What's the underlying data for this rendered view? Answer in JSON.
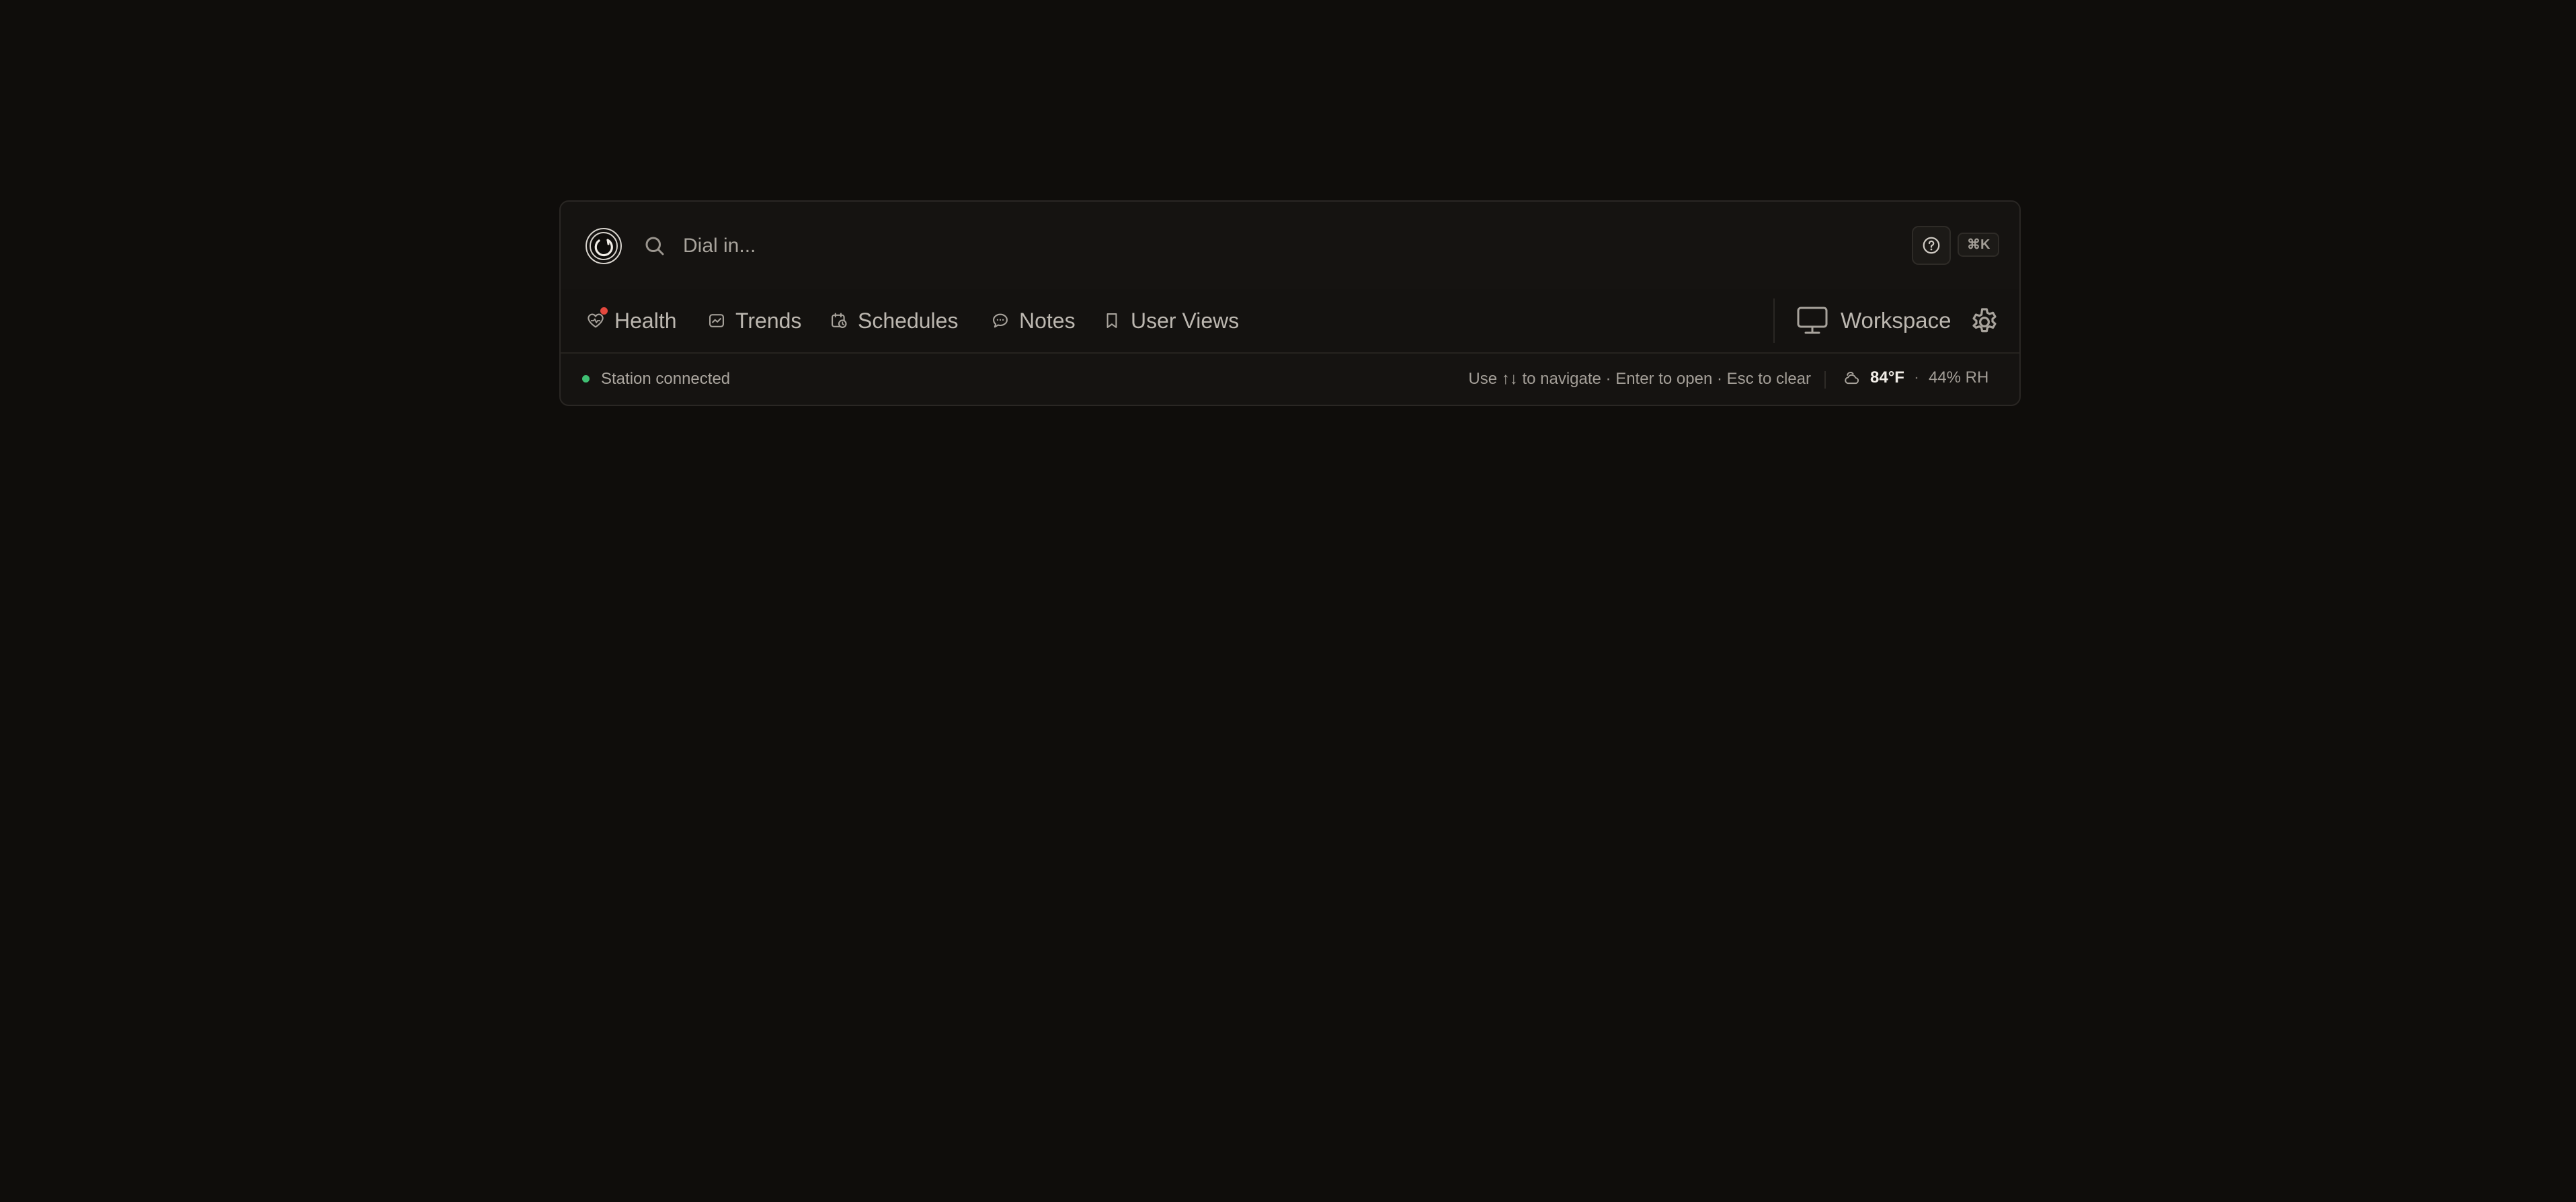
{
  "search": {
    "placeholder": "Dial in...",
    "shortcut": "⌘K"
  },
  "tabs": [
    {
      "label": "Health",
      "icon": "heart-pulse-icon",
      "alert": true
    },
    {
      "label": "Trends",
      "icon": "trends-icon"
    },
    {
      "label": "Schedules",
      "icon": "calendar-clock-icon"
    },
    {
      "label": "Notes",
      "icon": "chat-bubble-icon"
    },
    {
      "label": "User Views",
      "icon": "bookmark-icon"
    }
  ],
  "workspace": {
    "label": "Workspace",
    "icon": "monitor-icon"
  },
  "status": {
    "text": "Station connected",
    "hint": "Use ↑↓ to navigate · Enter to open · Esc to clear",
    "temperature": "84°F",
    "separator": "·",
    "humidity": "44% RH"
  },
  "colors": {
    "background": "#0f0d0b",
    "panel": "#151311",
    "status_ok": "#3fbf73",
    "alert": "#e5483e"
  }
}
